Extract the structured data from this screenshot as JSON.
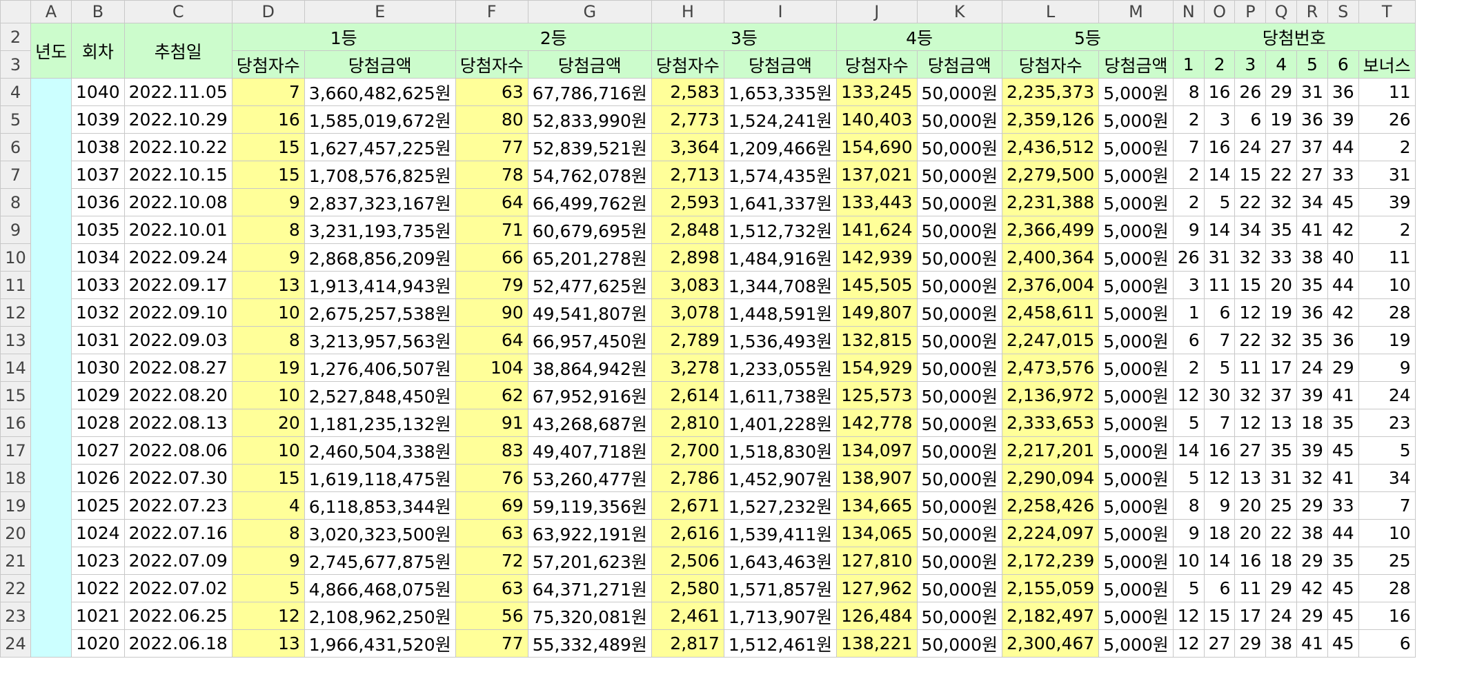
{
  "column_letters": [
    "A",
    "B",
    "C",
    "D",
    "E",
    "F",
    "G",
    "H",
    "I",
    "J",
    "K",
    "L",
    "M",
    "N",
    "O",
    "P",
    "Q",
    "R",
    "S",
    "T"
  ],
  "header": {
    "row2_label": "2",
    "row3_label": "3",
    "year": "년도",
    "round": "회차",
    "draw_date": "추첨일",
    "groups": [
      "1등",
      "2등",
      "3등",
      "4등",
      "5등",
      "당첨번호"
    ],
    "winners_label": "당첨자수",
    "amount_label": "당첨금액",
    "numbers": [
      "1",
      "2",
      "3",
      "4",
      "5",
      "6",
      "보너스"
    ]
  },
  "fill_colors": {
    "header_green": "#ccfccc",
    "winners_yellow": "#ffff99",
    "year_cyan": "#ccffff",
    "header_gray": "#efefef"
  },
  "rows": [
    {
      "row": "4",
      "r": "1040",
      "d": "2022.11.05",
      "w1": "7",
      "a1": "3,660,482,625원",
      "w2": "63",
      "a2": "67,786,716원",
      "w3": "2,583",
      "a3": "1,653,335원",
      "w4": "133,245",
      "a4": "50,000원",
      "w5": "2,235,373",
      "a5": "5,000원",
      "n": [
        "8",
        "16",
        "26",
        "29",
        "31",
        "36",
        "11"
      ]
    },
    {
      "row": "5",
      "r": "1039",
      "d": "2022.10.29",
      "w1": "16",
      "a1": "1,585,019,672원",
      "w2": "80",
      "a2": "52,833,990원",
      "w3": "2,773",
      "a3": "1,524,241원",
      "w4": "140,403",
      "a4": "50,000원",
      "w5": "2,359,126",
      "a5": "5,000원",
      "n": [
        "2",
        "3",
        "6",
        "19",
        "36",
        "39",
        "26"
      ]
    },
    {
      "row": "6",
      "r": "1038",
      "d": "2022.10.22",
      "w1": "15",
      "a1": "1,627,457,225원",
      "w2": "77",
      "a2": "52,839,521원",
      "w3": "3,364",
      "a3": "1,209,466원",
      "w4": "154,690",
      "a4": "50,000원",
      "w5": "2,436,512",
      "a5": "5,000원",
      "n": [
        "7",
        "16",
        "24",
        "27",
        "37",
        "44",
        "2"
      ]
    },
    {
      "row": "7",
      "r": "1037",
      "d": "2022.10.15",
      "w1": "15",
      "a1": "1,708,576,825원",
      "w2": "78",
      "a2": "54,762,078원",
      "w3": "2,713",
      "a3": "1,574,435원",
      "w4": "137,021",
      "a4": "50,000원",
      "w5": "2,279,500",
      "a5": "5,000원",
      "n": [
        "2",
        "14",
        "15",
        "22",
        "27",
        "33",
        "31"
      ]
    },
    {
      "row": "8",
      "r": "1036",
      "d": "2022.10.08",
      "w1": "9",
      "a1": "2,837,323,167원",
      "w2": "64",
      "a2": "66,499,762원",
      "w3": "2,593",
      "a3": "1,641,337원",
      "w4": "133,443",
      "a4": "50,000원",
      "w5": "2,231,388",
      "a5": "5,000원",
      "n": [
        "2",
        "5",
        "22",
        "32",
        "34",
        "45",
        "39"
      ]
    },
    {
      "row": "9",
      "r": "1035",
      "d": "2022.10.01",
      "w1": "8",
      "a1": "3,231,193,735원",
      "w2": "71",
      "a2": "60,679,695원",
      "w3": "2,848",
      "a3": "1,512,732원",
      "w4": "141,624",
      "a4": "50,000원",
      "w5": "2,366,499",
      "a5": "5,000원",
      "n": [
        "9",
        "14",
        "34",
        "35",
        "41",
        "42",
        "2"
      ]
    },
    {
      "row": "10",
      "r": "1034",
      "d": "2022.09.24",
      "w1": "9",
      "a1": "2,868,856,209원",
      "w2": "66",
      "a2": "65,201,278원",
      "w3": "2,898",
      "a3": "1,484,916원",
      "w4": "142,939",
      "a4": "50,000원",
      "w5": "2,400,364",
      "a5": "5,000원",
      "n": [
        "26",
        "31",
        "32",
        "33",
        "38",
        "40",
        "11"
      ]
    },
    {
      "row": "11",
      "r": "1033",
      "d": "2022.09.17",
      "w1": "13",
      "a1": "1,913,414,943원",
      "w2": "79",
      "a2": "52,477,625원",
      "w3": "3,083",
      "a3": "1,344,708원",
      "w4": "145,505",
      "a4": "50,000원",
      "w5": "2,376,004",
      "a5": "5,000원",
      "n": [
        "3",
        "11",
        "15",
        "20",
        "35",
        "44",
        "10"
      ]
    },
    {
      "row": "12",
      "r": "1032",
      "d": "2022.09.10",
      "w1": "10",
      "a1": "2,675,257,538원",
      "w2": "90",
      "a2": "49,541,807원",
      "w3": "3,078",
      "a3": "1,448,591원",
      "w4": "149,807",
      "a4": "50,000원",
      "w5": "2,458,611",
      "a5": "5,000원",
      "n": [
        "1",
        "6",
        "12",
        "19",
        "36",
        "42",
        "28"
      ]
    },
    {
      "row": "13",
      "r": "1031",
      "d": "2022.09.03",
      "w1": "8",
      "a1": "3,213,957,563원",
      "w2": "64",
      "a2": "66,957,450원",
      "w3": "2,789",
      "a3": "1,536,493원",
      "w4": "132,815",
      "a4": "50,000원",
      "w5": "2,247,015",
      "a5": "5,000원",
      "n": [
        "6",
        "7",
        "22",
        "32",
        "35",
        "36",
        "19"
      ]
    },
    {
      "row": "14",
      "r": "1030",
      "d": "2022.08.27",
      "w1": "19",
      "a1": "1,276,406,507원",
      "w2": "104",
      "a2": "38,864,942원",
      "w3": "3,278",
      "a3": "1,233,055원",
      "w4": "154,929",
      "a4": "50,000원",
      "w5": "2,473,576",
      "a5": "5,000원",
      "n": [
        "2",
        "5",
        "11",
        "17",
        "24",
        "29",
        "9"
      ]
    },
    {
      "row": "15",
      "r": "1029",
      "d": "2022.08.20",
      "w1": "10",
      "a1": "2,527,848,450원",
      "w2": "62",
      "a2": "67,952,916원",
      "w3": "2,614",
      "a3": "1,611,738원",
      "w4": "125,573",
      "a4": "50,000원",
      "w5": "2,136,972",
      "a5": "5,000원",
      "n": [
        "12",
        "30",
        "32",
        "37",
        "39",
        "41",
        "24"
      ]
    },
    {
      "row": "16",
      "r": "1028",
      "d": "2022.08.13",
      "w1": "20",
      "a1": "1,181,235,132원",
      "w2": "91",
      "a2": "43,268,687원",
      "w3": "2,810",
      "a3": "1,401,228원",
      "w4": "142,778",
      "a4": "50,000원",
      "w5": "2,333,653",
      "a5": "5,000원",
      "n": [
        "5",
        "7",
        "12",
        "13",
        "18",
        "35",
        "23"
      ]
    },
    {
      "row": "17",
      "r": "1027",
      "d": "2022.08.06",
      "w1": "10",
      "a1": "2,460,504,338원",
      "w2": "83",
      "a2": "49,407,718원",
      "w3": "2,700",
      "a3": "1,518,830원",
      "w4": "134,097",
      "a4": "50,000원",
      "w5": "2,217,201",
      "a5": "5,000원",
      "n": [
        "14",
        "16",
        "27",
        "35",
        "39",
        "45",
        "5"
      ]
    },
    {
      "row": "18",
      "r": "1026",
      "d": "2022.07.30",
      "w1": "15",
      "a1": "1,619,118,475원",
      "w2": "76",
      "a2": "53,260,477원",
      "w3": "2,786",
      "a3": "1,452,907원",
      "w4": "138,907",
      "a4": "50,000원",
      "w5": "2,290,094",
      "a5": "5,000원",
      "n": [
        "5",
        "12",
        "13",
        "31",
        "32",
        "41",
        "34"
      ]
    },
    {
      "row": "19",
      "r": "1025",
      "d": "2022.07.23",
      "w1": "4",
      "a1": "6,118,853,344원",
      "w2": "69",
      "a2": "59,119,356원",
      "w3": "2,671",
      "a3": "1,527,232원",
      "w4": "134,665",
      "a4": "50,000원",
      "w5": "2,258,426",
      "a5": "5,000원",
      "n": [
        "8",
        "9",
        "20",
        "25",
        "29",
        "33",
        "7"
      ]
    },
    {
      "row": "20",
      "r": "1024",
      "d": "2022.07.16",
      "w1": "8",
      "a1": "3,020,323,500원",
      "w2": "63",
      "a2": "63,922,191원",
      "w3": "2,616",
      "a3": "1,539,411원",
      "w4": "134,065",
      "a4": "50,000원",
      "w5": "2,224,097",
      "a5": "5,000원",
      "n": [
        "9",
        "18",
        "20",
        "22",
        "38",
        "44",
        "10"
      ]
    },
    {
      "row": "21",
      "r": "1023",
      "d": "2022.07.09",
      "w1": "9",
      "a1": "2,745,677,875원",
      "w2": "72",
      "a2": "57,201,623원",
      "w3": "2,506",
      "a3": "1,643,463원",
      "w4": "127,810",
      "a4": "50,000원",
      "w5": "2,172,239",
      "a5": "5,000원",
      "n": [
        "10",
        "14",
        "16",
        "18",
        "29",
        "35",
        "25"
      ]
    },
    {
      "row": "22",
      "r": "1022",
      "d": "2022.07.02",
      "w1": "5",
      "a1": "4,866,468,075원",
      "w2": "63",
      "a2": "64,371,271원",
      "w3": "2,580",
      "a3": "1,571,857원",
      "w4": "127,962",
      "a4": "50,000원",
      "w5": "2,155,059",
      "a5": "5,000원",
      "n": [
        "5",
        "6",
        "11",
        "29",
        "42",
        "45",
        "28"
      ]
    },
    {
      "row": "23",
      "r": "1021",
      "d": "2022.06.25",
      "w1": "12",
      "a1": "2,108,962,250원",
      "w2": "56",
      "a2": "75,320,081원",
      "w3": "2,461",
      "a3": "1,713,907원",
      "w4": "126,484",
      "a4": "50,000원",
      "w5": "2,182,497",
      "a5": "5,000원",
      "n": [
        "12",
        "15",
        "17",
        "24",
        "29",
        "45",
        "16"
      ]
    },
    {
      "row": "24",
      "r": "1020",
      "d": "2022.06.18",
      "w1": "13",
      "a1": "1,966,431,520원",
      "w2": "77",
      "a2": "55,332,489원",
      "w3": "2,817",
      "a3": "1,512,461원",
      "w4": "138,221",
      "a4": "50,000원",
      "w5": "2,300,467",
      "a5": "5,000원",
      "n": [
        "12",
        "27",
        "29",
        "38",
        "41",
        "45",
        "6"
      ]
    }
  ]
}
